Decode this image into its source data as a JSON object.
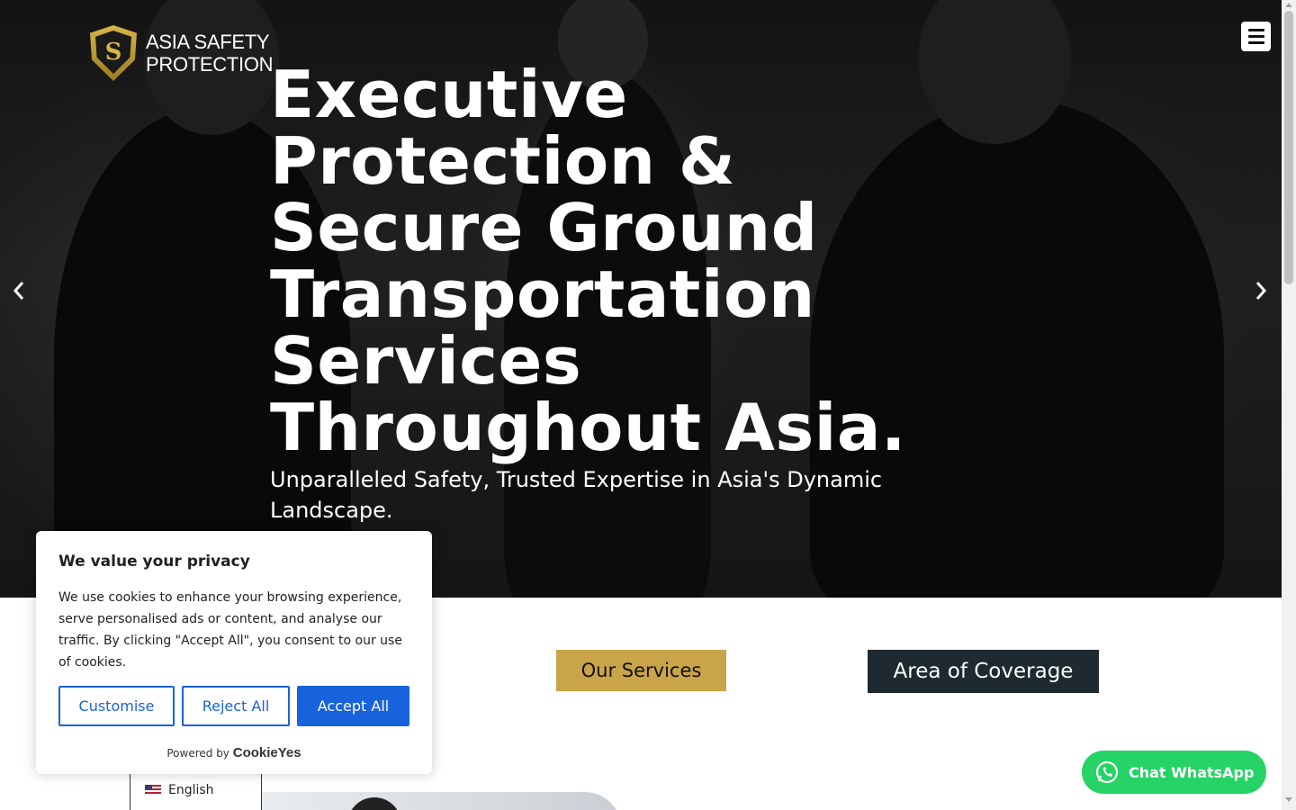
{
  "brand": {
    "logo_line1": "ASIA SAFETY",
    "logo_line2": "PROTECTION",
    "logo_icon": "shield-snake-icon",
    "gold": "#c9a448"
  },
  "header": {
    "menu_icon": "hamburger-icon"
  },
  "hero": {
    "title": "Executive Protection & Secure Ground Transportation Services Throughout Asia.",
    "subtitle": "Unparalleled Safety, Trusted Expertise in Asia's Dynamic Landscape.",
    "prev_icon": "chevron-left-icon",
    "next_icon": "chevron-right-icon"
  },
  "sections": {
    "services_label": "Our Services",
    "coverage_label": "Area of Coverage",
    "services_color": "#c9a448",
    "coverage_color": "#1e2a30"
  },
  "cookie_banner": {
    "title": "We value your privacy",
    "body": "We use cookies to enhance your browsing experience, serve personalised ads or content, and analyse our traffic. By clicking \"Accept All\", you consent to our use of cookies.",
    "customise_label": "Customise",
    "reject_label": "Reject All",
    "accept_label": "Accept All",
    "powered_by": "Powered by",
    "powered_brand": "CookieYes",
    "accent": "#1863dc"
  },
  "language": {
    "label": "English",
    "flag_icon": "us-flag-icon"
  },
  "whatsapp": {
    "label": "Chat WhatsApp",
    "icon": "whatsapp-icon",
    "color": "#25d366"
  }
}
